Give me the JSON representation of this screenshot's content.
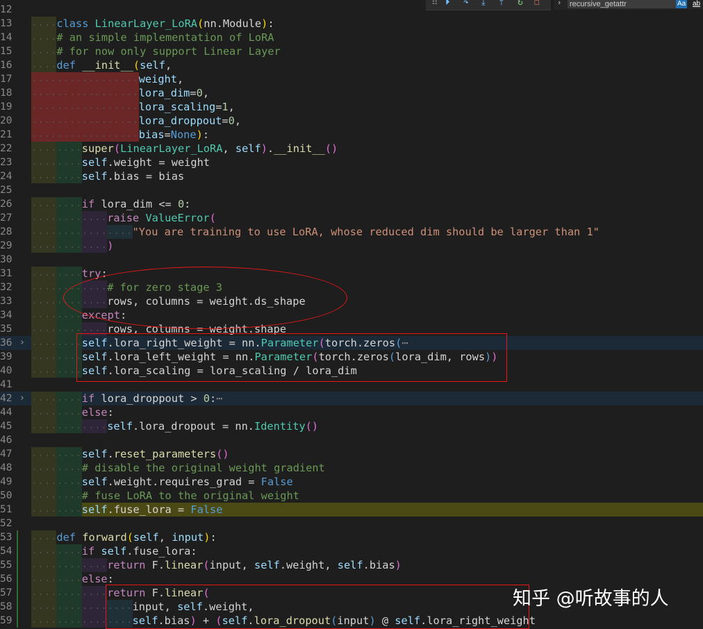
{
  "toolbar": {
    "debug_icons": [
      "drag-handle-icon",
      "continue-icon",
      "step-over-icon",
      "step-into-icon",
      "step-out-icon",
      "restart-icon",
      "stop-icon"
    ],
    "find_value": "recursive_getattr",
    "match_case_label": "Aa",
    "whole_word_label": "ab"
  },
  "lines": [
    {
      "num": "12",
      "tokens": []
    },
    {
      "num": "13",
      "tokens": [
        [
          "k",
          "class "
        ],
        [
          "cls",
          "LinearLayer_LoRA"
        ],
        [
          "br",
          "("
        ],
        [
          "t",
          "nn.Module"
        ],
        [
          "br",
          ")"
        ],
        [
          "t",
          ":"
        ]
      ]
    },
    {
      "num": "14",
      "tokens": [
        [
          "c",
          "# an simple implementation of LoRA"
        ]
      ]
    },
    {
      "num": "15",
      "tokens": [
        [
          "c",
          "# for now only support Linear Layer"
        ]
      ]
    },
    {
      "num": "16",
      "tokens": [
        [
          "k",
          "def "
        ],
        [
          "fn",
          "__init__"
        ],
        [
          "br",
          "("
        ],
        [
          "p",
          "self"
        ],
        [
          "t",
          ","
        ]
      ]
    },
    {
      "num": "17",
      "tokens": [
        [
          "p",
          "weight"
        ],
        [
          "t",
          ","
        ]
      ]
    },
    {
      "num": "18",
      "tokens": [
        [
          "p",
          "lora_dim"
        ],
        [
          "t",
          "="
        ],
        [
          "n",
          "0"
        ],
        [
          "t",
          ","
        ]
      ]
    },
    {
      "num": "19",
      "tokens": [
        [
          "p",
          "lora_scaling"
        ],
        [
          "t",
          "="
        ],
        [
          "n",
          "1"
        ],
        [
          "t",
          ","
        ]
      ]
    },
    {
      "num": "20",
      "tokens": [
        [
          "p",
          "lora_droppout"
        ],
        [
          "t",
          "="
        ],
        [
          "n",
          "0"
        ],
        [
          "t",
          ","
        ]
      ]
    },
    {
      "num": "21",
      "tokens": [
        [
          "p",
          "bias"
        ],
        [
          "t",
          "="
        ],
        [
          "k",
          "None"
        ],
        [
          "br",
          ")"
        ],
        [
          "t",
          ":"
        ]
      ]
    },
    {
      "num": "22",
      "tokens": [
        [
          "fn",
          "super"
        ],
        [
          "br2",
          "("
        ],
        [
          "cls",
          "LinearLayer_LoRA"
        ],
        [
          "t",
          ", "
        ],
        [
          "p",
          "self"
        ],
        [
          "br2",
          ")"
        ],
        [
          "t",
          "."
        ],
        [
          "fn",
          "__init__"
        ],
        [
          "br2",
          "()"
        ]
      ]
    },
    {
      "num": "23",
      "tokens": [
        [
          "p",
          "self"
        ],
        [
          "t",
          ".weight = weight"
        ]
      ]
    },
    {
      "num": "24",
      "tokens": [
        [
          "p",
          "self"
        ],
        [
          "t",
          ".bias = bias"
        ]
      ]
    },
    {
      "num": "25",
      "tokens": []
    },
    {
      "num": "26",
      "tokens": [
        [
          "kw2",
          "if "
        ],
        [
          "t",
          "lora_dim <= "
        ],
        [
          "n",
          "0"
        ],
        [
          "t",
          ":"
        ]
      ]
    },
    {
      "num": "27",
      "tokens": [
        [
          "kw2",
          "raise "
        ],
        [
          "cls",
          "ValueError"
        ],
        [
          "br2",
          "("
        ]
      ]
    },
    {
      "num": "28",
      "tokens": [
        [
          "s",
          "\"You are training to use LoRA, whose reduced dim should be larger than 1\""
        ]
      ]
    },
    {
      "num": "29",
      "tokens": [
        [
          "br2",
          ")"
        ]
      ]
    },
    {
      "num": "30",
      "tokens": []
    },
    {
      "num": "31",
      "tokens": [
        [
          "kw2",
          "try"
        ],
        [
          "t",
          ":"
        ]
      ]
    },
    {
      "num": "32",
      "tokens": [
        [
          "c",
          "# for zero stage 3"
        ]
      ]
    },
    {
      "num": "33",
      "tokens": [
        [
          "t",
          "rows, columns = weight.ds_shape"
        ]
      ]
    },
    {
      "num": "34",
      "tokens": [
        [
          "kw2",
          "except"
        ],
        [
          "t",
          ":"
        ]
      ]
    },
    {
      "num": "35",
      "tokens": [
        [
          "t",
          "rows, columns = weight.shape"
        ]
      ]
    },
    {
      "num": "36",
      "tokens": [
        [
          "p",
          "self"
        ],
        [
          "t",
          ".lora_right_weight = nn."
        ],
        [
          "cls",
          "Parameter"
        ],
        [
          "br2",
          "("
        ],
        [
          "t",
          "torch.zeros"
        ],
        [
          "bl",
          "("
        ],
        [
          "fold-e",
          "⋯"
        ]
      ]
    },
    {
      "num": "39",
      "tokens": [
        [
          "p",
          "self"
        ],
        [
          "t",
          ".lora_left_weight = nn."
        ],
        [
          "cls",
          "Parameter"
        ],
        [
          "br2",
          "("
        ],
        [
          "t",
          "torch.zeros"
        ],
        [
          "bl",
          "("
        ],
        [
          "t",
          "lora_dim, rows"
        ],
        [
          "bl",
          ")"
        ],
        [
          "br2",
          ")"
        ]
      ]
    },
    {
      "num": "40",
      "tokens": [
        [
          "p",
          "self"
        ],
        [
          "t",
          ".lora_scaling = lora_scaling / lora_dim"
        ]
      ]
    },
    {
      "num": "41",
      "tokens": []
    },
    {
      "num": "42",
      "tokens": [
        [
          "kw2",
          "if "
        ],
        [
          "t",
          "lora_droppout > "
        ],
        [
          "n",
          "0"
        ],
        [
          "t",
          ":"
        ],
        [
          "fold-e",
          "⋯"
        ]
      ]
    },
    {
      "num": "44",
      "tokens": [
        [
          "kw2",
          "else"
        ],
        [
          "t",
          ":"
        ]
      ]
    },
    {
      "num": "45",
      "tokens": [
        [
          "p",
          "self"
        ],
        [
          "t",
          ".lora_dropout = nn."
        ],
        [
          "cls",
          "Identity"
        ],
        [
          "br2",
          "()"
        ]
      ]
    },
    {
      "num": "46",
      "tokens": []
    },
    {
      "num": "47",
      "tokens": [
        [
          "p",
          "self"
        ],
        [
          "t",
          "."
        ],
        [
          "fn",
          "reset_parameters"
        ],
        [
          "br2",
          "()"
        ]
      ]
    },
    {
      "num": "48",
      "tokens": [
        [
          "c",
          "# disable the original weight gradient"
        ]
      ]
    },
    {
      "num": "49",
      "tokens": [
        [
          "p",
          "self"
        ],
        [
          "t",
          ".weight.requires_grad = "
        ],
        [
          "k",
          "False"
        ]
      ]
    },
    {
      "num": "50",
      "tokens": [
        [
          "c",
          "# fuse LoRA to the original weight"
        ]
      ]
    },
    {
      "num": "51",
      "tokens": [
        [
          "p",
          "self"
        ],
        [
          "t",
          ".fuse_lora = "
        ],
        [
          "k",
          "False"
        ]
      ]
    },
    {
      "num": "52",
      "tokens": []
    },
    {
      "num": "53",
      "tokens": [
        [
          "k",
          "def "
        ],
        [
          "fn",
          "forward"
        ],
        [
          "br",
          "("
        ],
        [
          "p",
          "self"
        ],
        [
          "t",
          ", "
        ],
        [
          "p",
          "input"
        ],
        [
          "br",
          ")"
        ],
        [
          "t",
          ":"
        ]
      ]
    },
    {
      "num": "54",
      "tokens": [
        [
          "kw2",
          "if "
        ],
        [
          "p",
          "self"
        ],
        [
          "t",
          ".fuse_lora:"
        ]
      ]
    },
    {
      "num": "55",
      "tokens": [
        [
          "kw2",
          "return "
        ],
        [
          "t",
          "F."
        ],
        [
          "fn",
          "linear"
        ],
        [
          "br2",
          "("
        ],
        [
          "t",
          "input, "
        ],
        [
          "p",
          "self"
        ],
        [
          "t",
          ".weight, "
        ],
        [
          "p",
          "self"
        ],
        [
          "t",
          ".bias"
        ],
        [
          "br2",
          ")"
        ]
      ]
    },
    {
      "num": "56",
      "tokens": [
        [
          "kw2",
          "else"
        ],
        [
          "t",
          ":"
        ]
      ]
    },
    {
      "num": "57",
      "tokens": [
        [
          "kw2",
          "return "
        ],
        [
          "t",
          "F."
        ],
        [
          "fn",
          "linear"
        ],
        [
          "br2",
          "("
        ]
      ]
    },
    {
      "num": "58",
      "tokens": [
        [
          "t",
          "input, "
        ],
        [
          "p",
          "self"
        ],
        [
          "t",
          ".weight,"
        ]
      ]
    },
    {
      "num": "59",
      "tokens": [
        [
          "p",
          "self"
        ],
        [
          "t",
          ".bias"
        ],
        [
          "br2",
          ")"
        ],
        [
          "t",
          " + "
        ],
        [
          "br2",
          "("
        ],
        [
          "p",
          "self"
        ],
        [
          "t",
          "."
        ],
        [
          "fn",
          "lora_dropout"
        ],
        [
          "bl",
          "("
        ],
        [
          "t",
          "input"
        ],
        [
          "bl",
          ")"
        ],
        [
          "t",
          " @ "
        ],
        [
          "p",
          "self"
        ],
        [
          "t",
          ".lora_right_weight"
        ]
      ]
    }
  ],
  "watermark": "知乎 @听故事的人"
}
